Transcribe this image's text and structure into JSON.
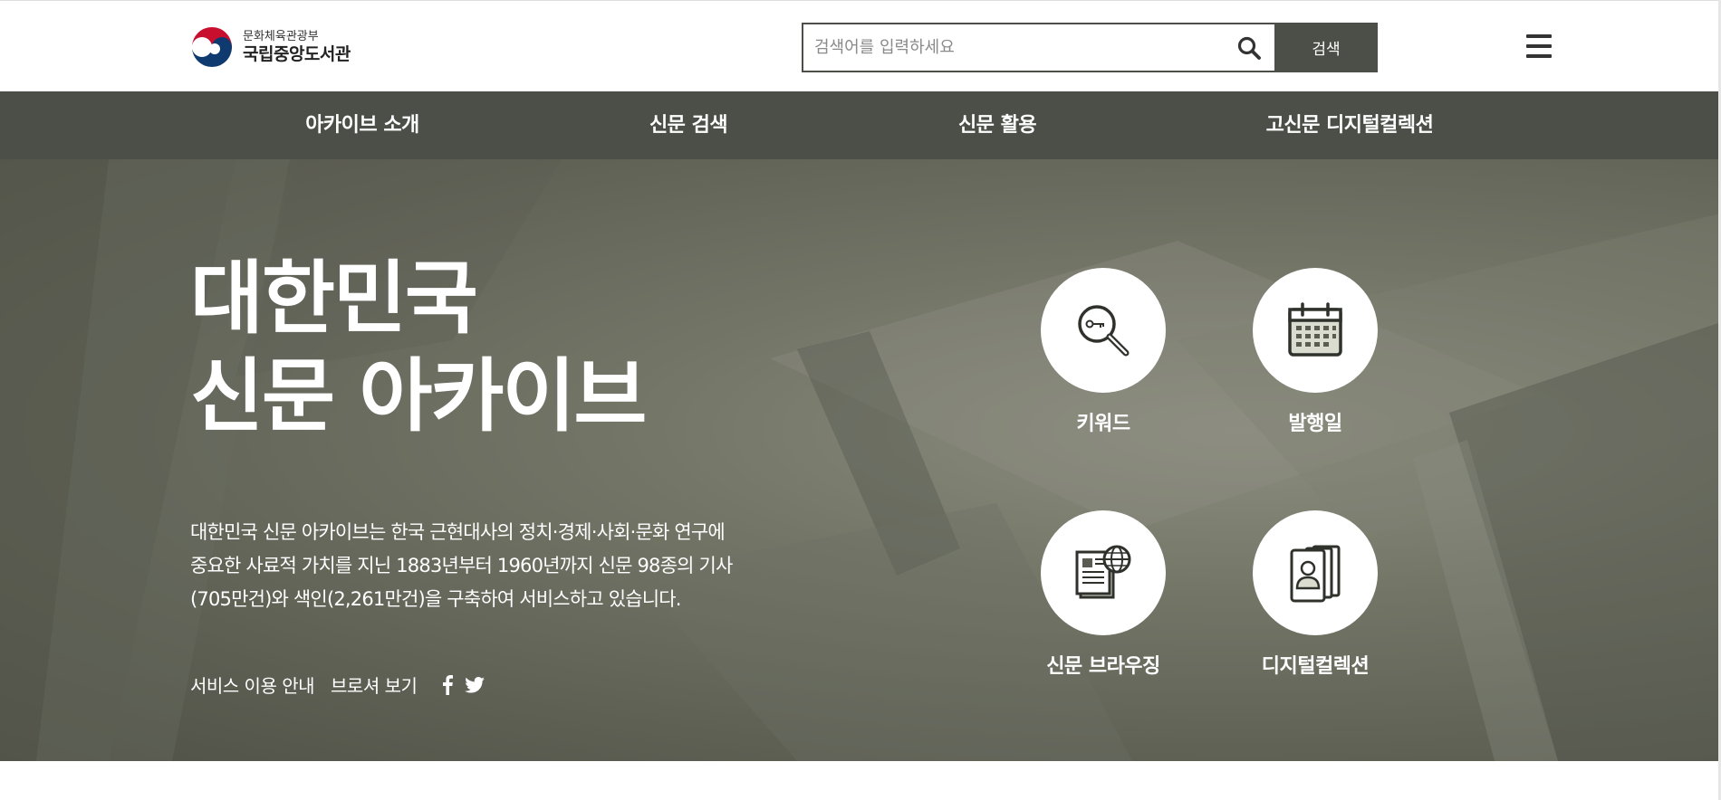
{
  "header": {
    "logo": {
      "ministry": "문화체육관광부",
      "name": "국립중앙도서관"
    },
    "search": {
      "placeholder": "검색어를 입력하세요",
      "value": "",
      "submit_label": "검색",
      "icon": "search-icon"
    },
    "menu_icon": "hamburger-icon"
  },
  "nav": {
    "items": [
      {
        "label": "아카이브 소개"
      },
      {
        "label": "신문 검색"
      },
      {
        "label": "신문 활용"
      },
      {
        "label": "고신문 디지털컬렉션"
      }
    ]
  },
  "hero": {
    "title_line1": "대한민국",
    "title_line2": "신문 아카이브",
    "description": "대한민국 신문 아카이브는 한국 근현대사의 정치·경제·사회·문화 연구에 중요한 사료적 가치를 지닌 1883년부터 1960년까지 신문 98종의 기사(705만건)와 색인(2,261만건)을 구축하여 서비스하고 있습니다.",
    "links": {
      "service_guide": "서비스 이용 안내",
      "browse": "브로셔 보기"
    },
    "social": [
      "facebook-icon",
      "twitter-icon"
    ],
    "quick_menu": [
      {
        "label": "키워드",
        "icon": "keyword-search-icon"
      },
      {
        "label": "발행일",
        "icon": "calendar-icon"
      },
      {
        "label": "신문 브라우징",
        "icon": "newspaper-globe-icon"
      },
      {
        "label": "디지털컬렉션",
        "icon": "portrait-cards-icon"
      }
    ]
  },
  "colors": {
    "accent": "#4b4f47",
    "hero_light": "#8c8e80",
    "hero_dark": "#4f5147",
    "calendar_fill": "#d9dccf"
  }
}
